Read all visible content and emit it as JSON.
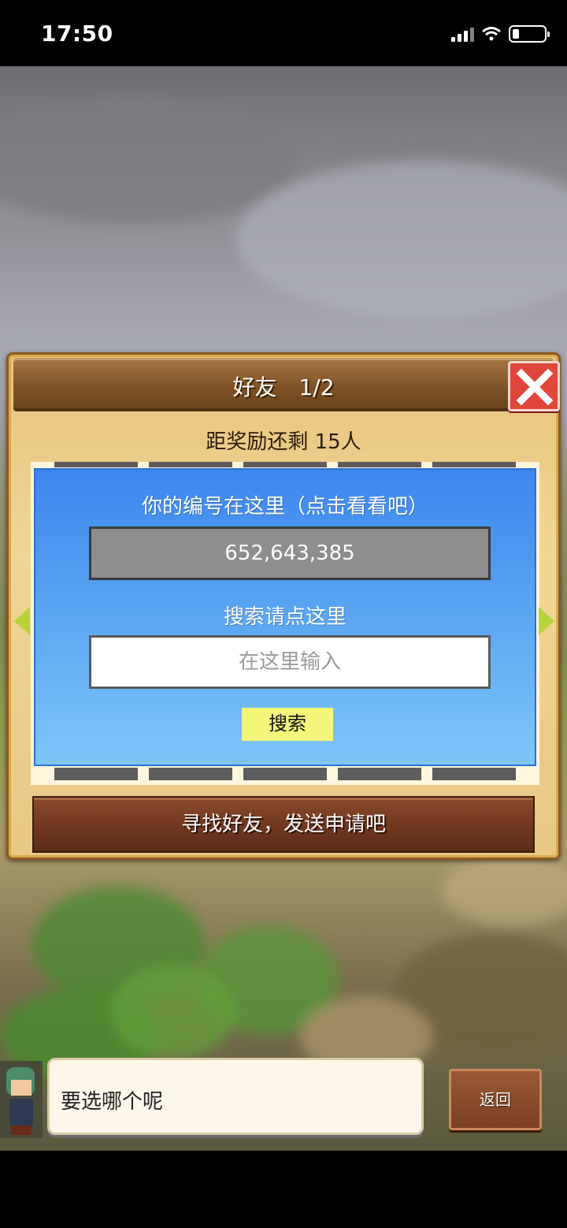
{
  "status_bar": {
    "time": "17:50"
  },
  "dialog": {
    "title": "好友　1/2",
    "reward_text": "距奖励还剩 15人",
    "id_label": "你的编号在这里（点击看看吧）",
    "id_value": "652,643,385",
    "search_label": "搜索请点这里",
    "search_placeholder": "在这里输入",
    "search_button": "搜索",
    "find_friends_button": "寻找好友，发送申请吧"
  },
  "speech": {
    "text": "要选哪个呢"
  },
  "back_button": "返回",
  "colors": {
    "panel_blue": "#3d86ef",
    "close_red": "#e0463a",
    "search_yellow": "#f4f57a",
    "wood_brown": "#7e5226"
  }
}
